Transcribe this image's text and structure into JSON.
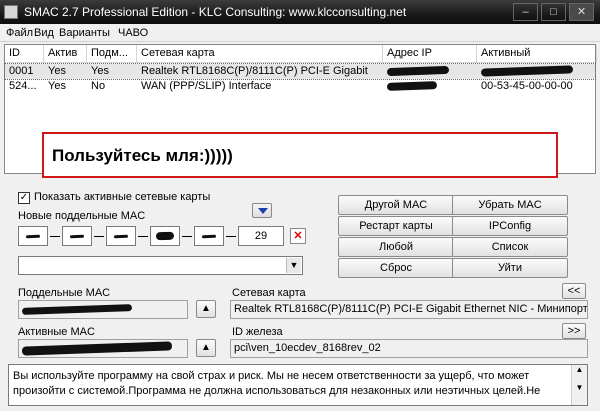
{
  "window": {
    "title": "SMAC 2.7 Professional Edition  -  KLC Consulting:  www.klcconsulting.net",
    "controls": [
      "minimize",
      "maximize",
      "close"
    ]
  },
  "menu": [
    "Файл",
    "Вид",
    "Варианты",
    "ЧАВО"
  ],
  "adapters": {
    "columns": [
      "ID",
      "Актив",
      "Подм...",
      "Сетевая карта",
      "Адрес IP",
      "Активный"
    ],
    "rows": [
      {
        "id": "0001",
        "active": "Yes",
        "spoofed": "Yes",
        "adapter": "Realtek RTL8168C(P)/8111C(P) PCI-E Gigabit",
        "ip": "",
        "mac": "",
        "selected": true
      },
      {
        "id": "524...",
        "active": "Yes",
        "spoofed": "No",
        "adapter": "WAN (PPP/SLIP) Interface",
        "ip": "",
        "mac": "00-53-45-00-00-00",
        "selected": false
      }
    ]
  },
  "overlay_text": "Пользуйтесь мля:)))))",
  "controls": {
    "show_active_label": "Показать активные сетевые  карты",
    "show_active_checked": true,
    "new_mac_label": "Новые поддельные MAC",
    "octets": [
      "",
      "",
      "",
      "",
      "",
      "29"
    ],
    "spoofed_mac_label": "Поддельные MAC",
    "active_mac_label": "Активные MAC",
    "network_card_label": "Сетевая карта",
    "network_card_value": "Realtek RTL8168C(P)/8111C(P) PCI-E Gigabit Ethernet NIC - Минипорт",
    "hardware_id_label": "ID железа",
    "hardware_id_value": "pci\\ven_10ecdev_8168rev_02",
    "prev_label": "<<",
    "next_label": ">>"
  },
  "buttons": {
    "other_mac": "Другой MAC",
    "remove_mac": "Убрать MAC",
    "restart_card": "Рестарт карты",
    "ipconfig": "IPConfig",
    "any": "Любой",
    "list": "Список",
    "reset": "Сброс",
    "exit": "Уйти"
  },
  "disclaimer": "Вы используйте программу на свой страх и риск.  Мы не несем ответственности за ущерб, что может произойти с системой.Программа не должна использоваться для незаконных или неэтичных целей.Не"
}
